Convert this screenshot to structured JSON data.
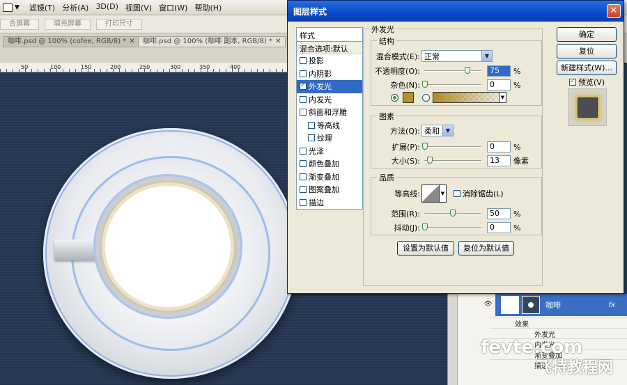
{
  "menubar": {
    "items": [
      "滤镜(T)",
      "分析(A)",
      "3D(D)",
      "视图(V)",
      "窗口(W)",
      "帮助(H)"
    ]
  },
  "optionsbar": {
    "buttons": [
      "合屏幕",
      "填充屏幕",
      "打印尺寸"
    ]
  },
  "tabs": [
    "咖啡.psd @ 100% (cofee, RGB/8) *",
    "咖啡.psd @ 100% (咖啡 副本, RGB/8) *"
  ],
  "ruler": {
    "ticks": [
      "50",
      "100",
      "150",
      "200",
      "250",
      "300",
      "350",
      "400"
    ]
  },
  "dialog": {
    "title": "图层样式",
    "close": "✕",
    "styles_header": "样式",
    "blend_options": "混合选项:默认",
    "styles": [
      {
        "label": "投影",
        "checked": false,
        "indent": false,
        "selected": false
      },
      {
        "label": "内阴影",
        "checked": false,
        "indent": false,
        "selected": false
      },
      {
        "label": "外发光",
        "checked": true,
        "indent": false,
        "selected": true
      },
      {
        "label": "内发光",
        "checked": false,
        "indent": false,
        "selected": false
      },
      {
        "label": "斜面和浮雕",
        "checked": false,
        "indent": false,
        "selected": false
      },
      {
        "label": "等高线",
        "checked": false,
        "indent": true,
        "selected": false
      },
      {
        "label": "纹理",
        "checked": false,
        "indent": true,
        "selected": false
      },
      {
        "label": "光泽",
        "checked": false,
        "indent": false,
        "selected": false
      },
      {
        "label": "颜色叠加",
        "checked": false,
        "indent": false,
        "selected": false
      },
      {
        "label": "渐变叠加",
        "checked": false,
        "indent": false,
        "selected": false
      },
      {
        "label": "图案叠加",
        "checked": false,
        "indent": false,
        "selected": false
      },
      {
        "label": "描边",
        "checked": false,
        "indent": false,
        "selected": false
      }
    ],
    "panel_title": "外发光",
    "structure": {
      "title": "结构",
      "blend_mode_label": "混合模式(E):",
      "blend_mode_value": "正常",
      "opacity_label": "不透明度(O):",
      "opacity_value": "75",
      "opacity_unit": "%",
      "noise_label": "杂色(N):",
      "noise_value": "0",
      "noise_unit": "%",
      "color": "#b8902a"
    },
    "elements": {
      "title": "图素",
      "method_label": "方法(Q):",
      "method_value": "柔和",
      "spread_label": "扩展(P):",
      "spread_value": "0",
      "spread_unit": "%",
      "size_label": "大小(S):",
      "size_value": "13",
      "size_unit": "像素"
    },
    "quality": {
      "title": "品质",
      "contour_label": "等高线:",
      "antialias_label": "消除锯齿(L)",
      "range_label": "范围(R):",
      "range_value": "50",
      "range_unit": "%",
      "jitter_label": "抖动(J):",
      "jitter_value": "0",
      "jitter_unit": "%"
    },
    "set_default": "设置为默认值",
    "reset_default": "复位为默认值",
    "ok": "确定",
    "reset": "复位",
    "new_style": "新建样式(W)...",
    "preview_label": "预览(V)"
  },
  "layers": {
    "layer_name": "咖啡",
    "fx": "fx",
    "effects": [
      "效果",
      "外发光",
      "内发光",
      "渐变叠加",
      "描边"
    ]
  },
  "watermark": {
    "line1": "fevte.com",
    "line2": "飞特教程网"
  }
}
